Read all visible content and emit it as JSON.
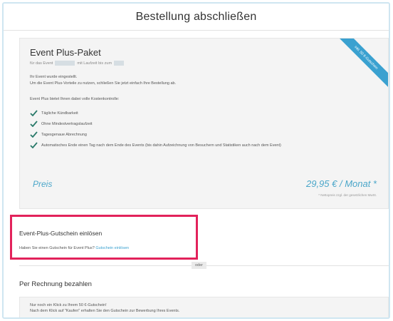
{
  "page": {
    "title": "Bestellung abschließen"
  },
  "package": {
    "title": "Event Plus-Paket",
    "subtitle_part1": "für das Event",
    "subtitle_part2": "mit Laufzeit bis zum",
    "intro_line1": "Ihr Event wurde eingestellt.",
    "intro_line2": "Um die Event Plus-Vorteile zu nutzen, schließen Sie jetzt einfach Ihre Bestellung ab.",
    "features_intro": "Event Plus bietet Ihnen dabei volle Kostenkontrolle:",
    "features": [
      "Tägliche Kündbarkeit",
      "Ohne Mindestvertragslaufzeit",
      "Tagesgenaue Abrechnung",
      "Automatisches Ende einen Tag nach dem Ende des Events (bis dahin Aufzeichnung von Besuchern und Statistiken auch nach dem Event)"
    ],
    "price_label": "Preis",
    "price_value": "29,95 € / Monat *",
    "price_note": "* Nettopreis zzgl. der gesetzlichen MwSt.",
    "ribbon": "inkl. 50 €-Gutschein"
  },
  "voucher": {
    "title": "Event-Plus-Gutschein einlösen",
    "question": "Haben Sie einen Gutschein für Event Plus?",
    "link": "Gutschein einlösen"
  },
  "separator": {
    "label": "oder"
  },
  "invoice": {
    "title": "Per Rechnung bezahlen",
    "line1": "Nur noch ein Klick zu Ihrem 50 €-Gutschein!",
    "line2": "Nach dem Klick auf \"Kaufen\" erhalten Sie den Gutschein zur Bewerbung Ihres Events."
  },
  "colors": {
    "accent": "#3aa1d0",
    "highlight_border": "#e2225b",
    "check": "#2a7a6a"
  },
  "icons": {
    "feature_check": "checkmark-icon"
  }
}
